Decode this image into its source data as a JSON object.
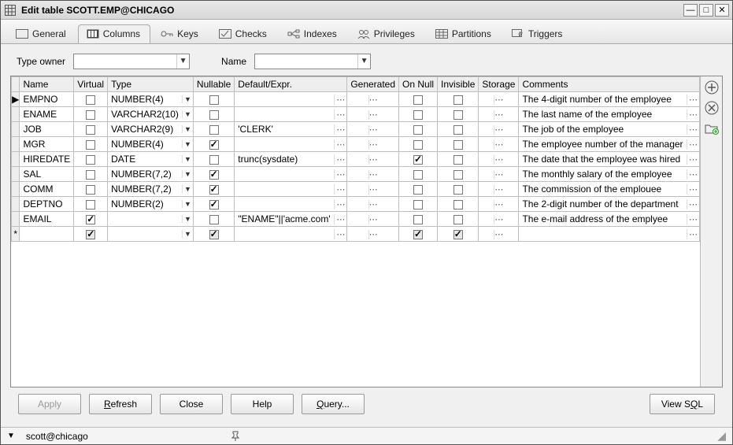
{
  "window": {
    "title": "Edit table SCOTT.EMP@CHICAGO"
  },
  "tabs": [
    {
      "id": "general",
      "label": "General"
    },
    {
      "id": "columns",
      "label": "Columns",
      "active": true
    },
    {
      "id": "keys",
      "label": "Keys"
    },
    {
      "id": "checks",
      "label": "Checks"
    },
    {
      "id": "indexes",
      "label": "Indexes"
    },
    {
      "id": "privileges",
      "label": "Privileges"
    },
    {
      "id": "partitions",
      "label": "Partitions"
    },
    {
      "id": "triggers",
      "label": "Triggers"
    }
  ],
  "filters": {
    "type_owner_label": "Type owner",
    "name_label": "Name",
    "type_owner_value": "",
    "name_value": ""
  },
  "grid": {
    "headers": [
      "Name",
      "Virtual",
      "Type",
      "Nullable",
      "Default/Expr.",
      "Generated",
      "On Null",
      "Invisible",
      "Storage",
      "Comments"
    ],
    "rows": [
      {
        "marker": "▶",
        "name": "EMPNO",
        "virtual": false,
        "type": "NUMBER(4)",
        "nullable": false,
        "default": "",
        "onnull": false,
        "invisible": false,
        "comment": "The 4-digit number of the employee"
      },
      {
        "marker": "",
        "name": "ENAME",
        "virtual": false,
        "type": "VARCHAR2(10)",
        "nullable": false,
        "default": "",
        "onnull": false,
        "invisible": false,
        "comment": "The last name of the employee"
      },
      {
        "marker": "",
        "name": "JOB",
        "virtual": false,
        "type": "VARCHAR2(9)",
        "nullable": false,
        "default": "'CLERK'",
        "onnull": false,
        "invisible": false,
        "comment": "The job of the employee"
      },
      {
        "marker": "",
        "name": "MGR",
        "virtual": false,
        "type": "NUMBER(4)",
        "nullable": true,
        "default": "",
        "onnull": false,
        "invisible": false,
        "comment": "The employee number of the manager"
      },
      {
        "marker": "",
        "name": "HIREDATE",
        "virtual": false,
        "type": "DATE",
        "nullable": false,
        "default": "trunc(sysdate)",
        "onnull": true,
        "invisible": false,
        "comment": "The date that the employee was hired"
      },
      {
        "marker": "",
        "name": "SAL",
        "virtual": false,
        "type": "NUMBER(7,2)",
        "nullable": true,
        "default": "",
        "onnull": false,
        "invisible": false,
        "comment": "The monthly salary of the employee"
      },
      {
        "marker": "",
        "name": "COMM",
        "virtual": false,
        "type": "NUMBER(7,2)",
        "nullable": true,
        "default": "",
        "onnull": false,
        "invisible": false,
        "comment": "The commission of the emplouee"
      },
      {
        "marker": "",
        "name": "DEPTNO",
        "virtual": false,
        "type": "NUMBER(2)",
        "nullable": true,
        "default": "",
        "onnull": false,
        "invisible": false,
        "comment": "The 2-digit number of the department"
      },
      {
        "marker": "",
        "name": "EMAIL",
        "virtual": true,
        "type": "",
        "nullable": false,
        "default": "\"ENAME\"||'acme.com'",
        "onnull": false,
        "invisible": false,
        "comment": "The e-mail address of the emplyee"
      }
    ],
    "newrow_marker": "*"
  },
  "buttons": {
    "apply": "Apply",
    "refresh": "Refresh",
    "close": "Close",
    "help": "Help",
    "query": "Query...",
    "view_sql": "View SQL"
  },
  "status": {
    "connection": "scott@chicago"
  }
}
